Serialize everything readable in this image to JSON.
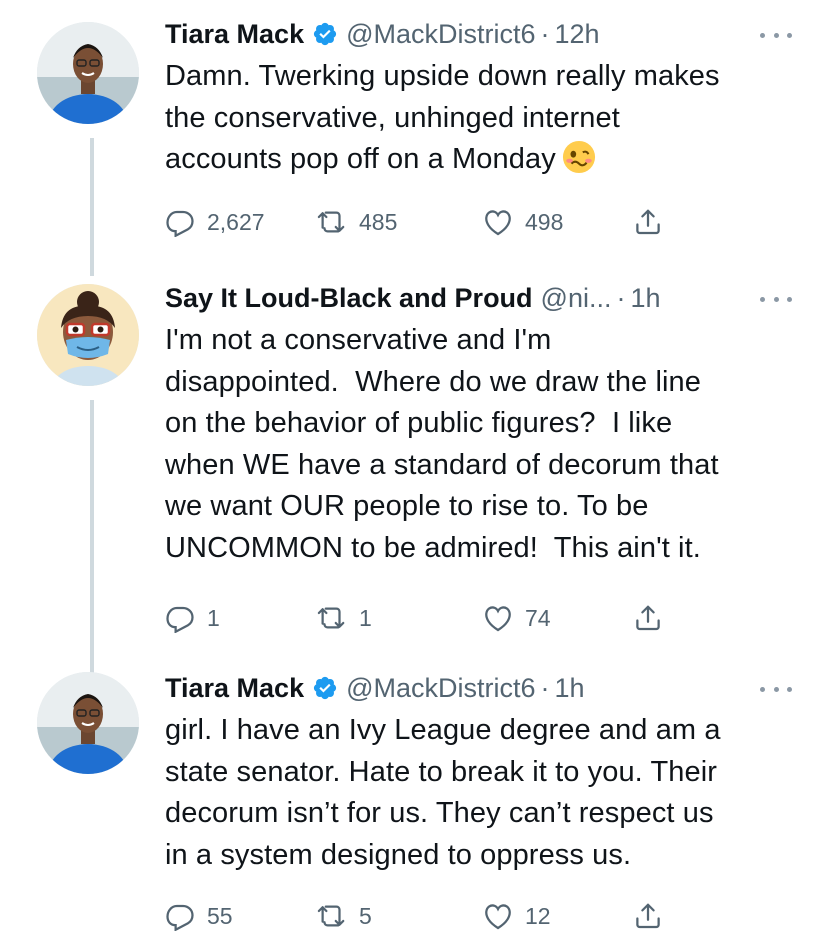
{
  "tweets": [
    {
      "display_name": "Tiara Mack",
      "verified": true,
      "handle": "@MackDistrict6",
      "separator": "·",
      "time": "12h",
      "text": "Damn. Twerking upside down really makes\nthe conservative, unhinged internet\naccounts pop off on a Monday",
      "emoji": "woozy-face",
      "stats": {
        "replies": "2,627",
        "retweets": "485",
        "likes": "498"
      }
    },
    {
      "display_name": "Say It Loud-Black and Proud",
      "verified": false,
      "handle": "@ni...",
      "separator": "·",
      "time": "1h",
      "text": "I'm not a conservative and I'm\ndisappointed.  Where do we draw the line\non the behavior of public figures?  I like\nwhen WE have a standard of decorum that\nwe want OUR people to rise to. To be\nUNCOMMON to be admired!  This ain't it.",
      "stats": {
        "replies": "1",
        "retweets": "1",
        "likes": "74"
      }
    },
    {
      "display_name": "Tiara Mack",
      "verified": true,
      "handle": "@MackDistrict6",
      "separator": "·",
      "time": "1h",
      "text": "girl. I have an Ivy League degree and am a\nstate senator. Hate to break it to you. Their\ndecorum isn’t for us. They can’t respect us\nin a system designed to oppress us.",
      "stats": {
        "replies": "55",
        "retweets": "5",
        "likes": "12"
      }
    }
  ],
  "colors": {
    "text": "#0f1419",
    "secondary": "#536471",
    "verified": "#1d9bf0",
    "thread_line": "#cfd9de"
  }
}
